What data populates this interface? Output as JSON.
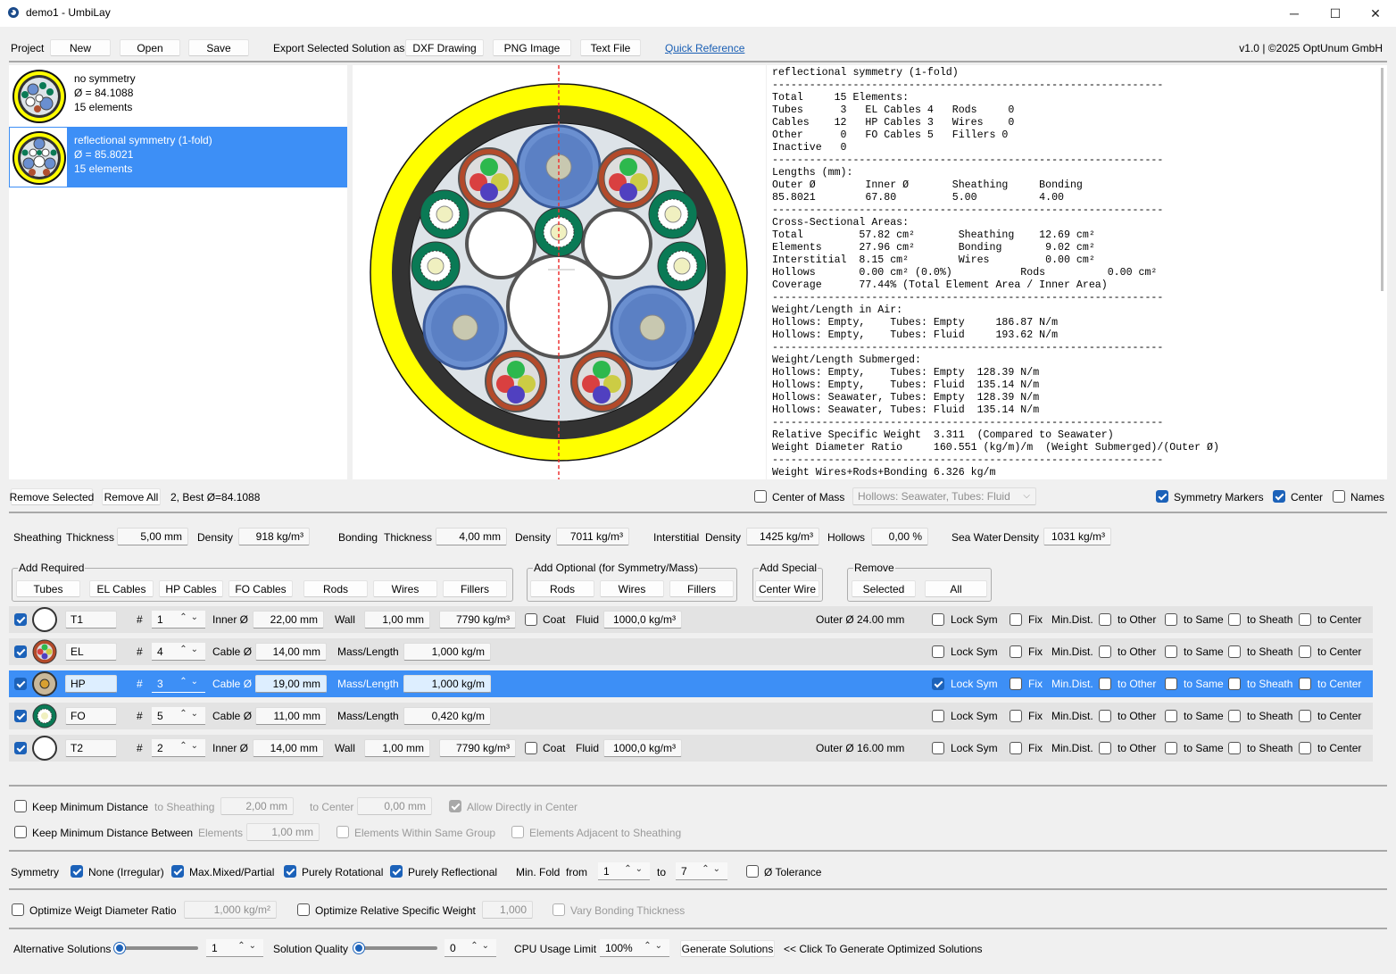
{
  "window": {
    "title": "demo1 - UmbiLay",
    "minimize": "─",
    "maximize": "☐",
    "close": "✕"
  },
  "menu": {
    "project_label": "Project",
    "new": "New",
    "open": "Open",
    "save": "Save",
    "export_label": "Export Selected Solution as",
    "dxf": "DXF Drawing",
    "png": "PNG Image",
    "text": "Text File",
    "quick_ref": "Quick Reference",
    "version": "v1.0 | ©2025 OptUnum GmbH"
  },
  "solutions": [
    {
      "name": "no symmetry",
      "diam": "Ø = 84.1088",
      "elements": "15 elements"
    },
    {
      "name": "reflectional symmetry (1-fold)",
      "diam": "Ø = 85.8021",
      "elements": "15 elements"
    }
  ],
  "report_text": "reflectional symmetry (1-fold)\n---------------------------------------------------------------\nTotal     15 Elements:\nTubes      3   EL Cables 4   Rods     0\nCables    12   HP Cables 3   Wires    0\nOther      0   FO Cables 5   Fillers 0\nInactive   0\n---------------------------------------------------------------\nLengths (mm):\nOuter Ø        Inner Ø       Sheathing     Bonding\n85.8021        67.80         5.00          4.00\n---------------------------------------------------------------\nCross-Sectional Areas:\nTotal         57.82 cm²       Sheathing    12.69 cm²\nElements      27.96 cm²       Bonding       9.02 cm²\nInterstitial  8.15 cm²        Wires         0.00 cm²\nHollows       0.00 cm² (0.0%)           Rods          0.00 cm²\nCoverage      77.44% (Total Element Area / Inner Area)\n---------------------------------------------------------------\nWeight/Length in Air:\nHollows: Empty,    Tubes: Empty     186.87 N/m\nHollows: Empty,    Tubes: Fluid     193.62 N/m\n---------------------------------------------------------------\nWeight/Length Submerged:\nHollows: Empty,    Tubes: Empty  128.39 N/m\nHollows: Empty,    Tubes: Fluid  135.14 N/m\nHollows: Seawater, Tubes: Empty  128.39 N/m\nHollows: Seawater, Tubes: Fluid  135.14 N/m\n---------------------------------------------------------------\nRelative Specific Weight  3.311  (Compared to Seawater)\nWeight Diameter Ratio     160.551 (kg/m)/m  (Weight Submerged)/(Outer Ø)\n---------------------------------------------------------------\nWeight Wires+Rods+Bonding 6.326 kg/m",
  "listbar": {
    "remove_selected": "Remove Selected",
    "remove_all": "Remove All",
    "best": "2, Best Ø=84.1088",
    "center_of_mass": "Center of Mass",
    "hollows_select": "Hollows: Seawater, Tubes: Fluid",
    "symmetry_markers": "Symmetry Markers",
    "center": "Center",
    "names": "Names"
  },
  "params": {
    "sheathing": "Sheathing",
    "thickness": "Thickness",
    "sheath_thick": "5,00 mm",
    "density": "Density",
    "sheath_dens": "918 kg/m³",
    "bonding": "Bonding",
    "bond_thick": "4,00 mm",
    "bond_dens": "7011 kg/m³",
    "interstitial": "Interstitial",
    "inter_dens": "1425 kg/m³",
    "hollows": "Hollows",
    "hollows_val": "0,00 %",
    "seawater": "Sea Water",
    "sea_dens": "1031 kg/m³"
  },
  "groups": {
    "required": "Add Required",
    "optional": "Add Optional (for Symmetry/Mass)",
    "special": "Add Special",
    "remove": "Remove",
    "tubes": "Tubes",
    "el": "EL Cables",
    "hp": "HP Cables",
    "fo": "FO Cables",
    "rods": "Rods",
    "wires": "Wires",
    "fillers": "Fillers",
    "center_wire": "Center Wire",
    "selected": "Selected",
    "all": "All"
  },
  "elrows": [
    {
      "name": "T1",
      "count": "1",
      "kind": "tube",
      "inner_label": "Inner Ø",
      "inner": "22,00 mm",
      "wall_label": "Wall",
      "wall": "1,00 mm",
      "dens": "7790 kg/m³",
      "coat": "Coat",
      "fluid_label": "Fluid",
      "fluid": "1000,0 kg/m³",
      "outer": "Outer Ø 24.00 mm",
      "lock": false,
      "sel": false
    },
    {
      "name": "EL",
      "count": "4",
      "kind": "cable",
      "inner_label": "Cable Ø",
      "inner": "14,00 mm",
      "wall_label": "Mass/Length",
      "wall": "1,000 kg/m",
      "lock": false,
      "sel": false
    },
    {
      "name": "HP",
      "count": "3",
      "kind": "cable",
      "inner_label": "Cable Ø",
      "inner": "19,00 mm",
      "wall_label": "Mass/Length",
      "wall": "1,000 kg/m",
      "lock": true,
      "sel": true
    },
    {
      "name": "FO",
      "count": "5",
      "kind": "cable",
      "inner_label": "Cable Ø",
      "inner": "11,00 mm",
      "wall_label": "Mass/Length",
      "wall": "0,420 kg/m",
      "lock": false,
      "sel": false
    },
    {
      "name": "T2",
      "count": "2",
      "kind": "tube",
      "inner_label": "Inner Ø",
      "inner": "14,00 mm",
      "wall_label": "Wall",
      "wall": "1,00 mm",
      "dens": "7790 kg/m³",
      "coat": "Coat",
      "fluid_label": "Fluid",
      "fluid": "1000,0 kg/m³",
      "outer": "Outer Ø 16.00 mm",
      "lock": false,
      "sel": false
    }
  ],
  "rowlabels": {
    "hash": "#",
    "lock_sym": "Lock Sym",
    "fix": "Fix",
    "min_dist": "Min.Dist.",
    "to_other": "to Other",
    "to_same": "to Same",
    "to_sheath": "to Sheath",
    "to_center": "to Center"
  },
  "constraints": {
    "keep_min": "Keep Minimum Distance",
    "to_sheathing": "to Sheathing",
    "sheath_val": "2,00 mm",
    "to_center": "to Center",
    "center_val": "0,00 mm",
    "allow_center": "Allow Directly in Center",
    "keep_between": "Keep Minimum Distance Between",
    "elements": "Elements",
    "elements_val": "1,00 mm",
    "within_group": "Elements Within Same Group",
    "adjacent": "Elements Adjacent to Sheathing"
  },
  "symmetry": {
    "label": "Symmetry",
    "none": "None (Irregular)",
    "max_mixed": "Max.Mixed/Partial",
    "rotational": "Purely Rotational",
    "reflectional": "Purely Reflectional",
    "min_fold": "Min. Fold",
    "from": "from",
    "from_val": "1",
    "to": "to",
    "to_val": "7",
    "tolerance": "Ø Tolerance"
  },
  "optimize": {
    "weight_ratio": "Optimize Weigt Diameter Ratio",
    "weight_val": "1,000 kg/m²",
    "rel_weight": "Optimize Relative Specific Weight",
    "rel_val": "1,000",
    "vary_bond": "Vary Bonding Thickness"
  },
  "bottom": {
    "alt": "Alternative Solutions",
    "alt_val": "1",
    "quality": "Solution Quality",
    "quality_val": "0",
    "cpu": "CPU Usage Limit",
    "cpu_val": "100%",
    "generate": "Generate Solutions",
    "hint": "<< Click To Generate Optimized Solutions"
  },
  "colors": {
    "accent": "#3d8ff6",
    "sheath": "#ffff00",
    "bonding": "#333333",
    "interior": "#dde3e8"
  }
}
